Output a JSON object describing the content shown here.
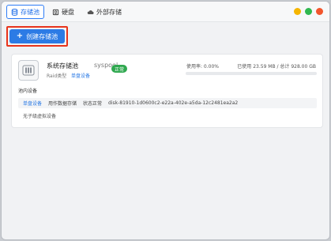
{
  "tabs": [
    {
      "label": "存储池",
      "icon": "database-icon",
      "active": true
    },
    {
      "label": "硬盘",
      "icon": "disk-icon",
      "active": false
    },
    {
      "label": "外部存储",
      "icon": "cloud-icon",
      "active": false
    }
  ],
  "window_controls": {
    "colors": [
      "#f5b500",
      "#2fb84f",
      "#f2552c"
    ]
  },
  "create_button": {
    "label": "创建存储池"
  },
  "pool": {
    "name": "系统存储池",
    "id": "syspool",
    "raid_label": "Raid类型",
    "raid_value": "单盘设备",
    "status": "正常",
    "usage_rate_text": "使用率: 0.00%",
    "usage_total_text": "已使用 23.59 MB / 总计 928.00 GB",
    "usage_fraction": 0.0,
    "section_title": "池内设备",
    "device": {
      "type": "单盘设备",
      "role": "用作数据存储",
      "status": "状态正常",
      "disk": "disk-81910-1d0600c2-e22a-402e-a5da-12c2481ea2a2"
    },
    "no_virtual": "无子级虚拟设备"
  }
}
